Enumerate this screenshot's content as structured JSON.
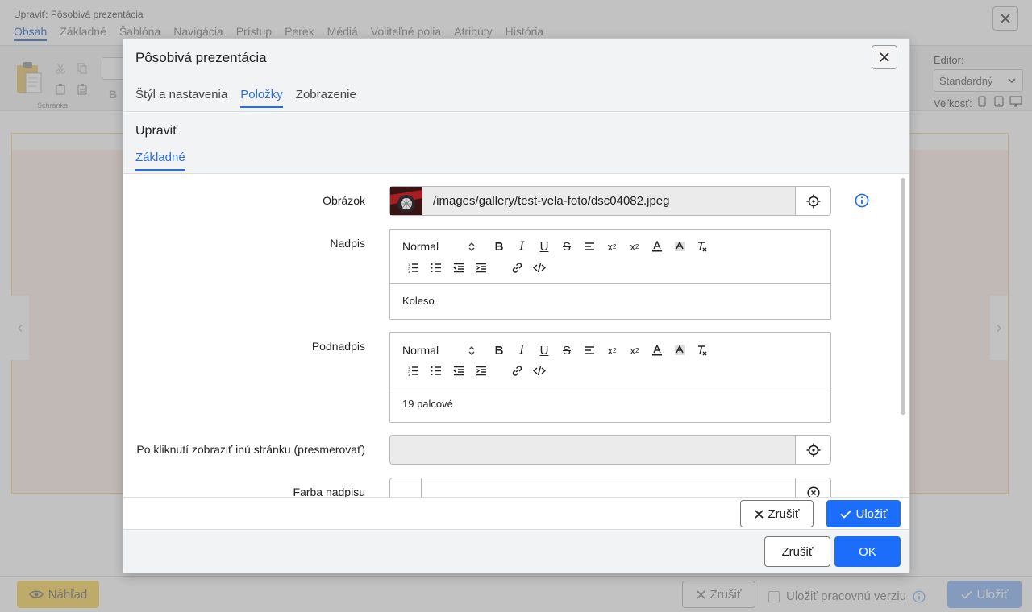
{
  "background": {
    "title": "Upraviť: Pôsobivá prezentácia",
    "tabs": [
      "Obsah",
      "Základné",
      "Šablóna",
      "Navigácia",
      "Prístup",
      "Perex",
      "Médiá",
      "Voliteľné polia",
      "Atribúty",
      "História"
    ],
    "toolbar_group_label": "Schránka",
    "editor_label": "Editor:",
    "editor_value": "Štandardný",
    "size_label": "Veľkosť:",
    "preview_label": "Náhľad",
    "cancel_label": "Zrušiť",
    "draft_label": "Uložiť pracovnú verziu",
    "save_label": "Uložiť"
  },
  "dialog": {
    "title": "Pôsobivá prezentácia",
    "tabs": [
      "Štýl a nastavenia",
      "Položky",
      "Zobrazenie"
    ],
    "active_tab": "Položky",
    "cancel_label": "Zrušiť",
    "ok_label": "OK"
  },
  "edit": {
    "title": "Upraviť",
    "tab": "Základné",
    "cancel_label": "Zrušiť",
    "save_label": "Uložiť",
    "fields": {
      "image": {
        "label": "Obrázok",
        "value": "/images/gallery/test-vela-foto/dsc04082.jpeg"
      },
      "heading": {
        "label": "Nadpis",
        "format": "Normal",
        "content": "Koleso"
      },
      "subheading": {
        "label": "Podnadpis",
        "format": "Normal",
        "content": "19 palcové"
      },
      "redirect": {
        "label": "Po kliknutí zobraziť inú stránku (presmerovať)",
        "value": ""
      },
      "heading_color": {
        "label": "Farba nadpisu",
        "value": ""
      }
    }
  },
  "colors": {
    "accent": "#1b6dfa",
    "tab_active": "#2b6fd6",
    "info_icon": "#1b6dfa",
    "preview_btn": "#f7d35d"
  }
}
